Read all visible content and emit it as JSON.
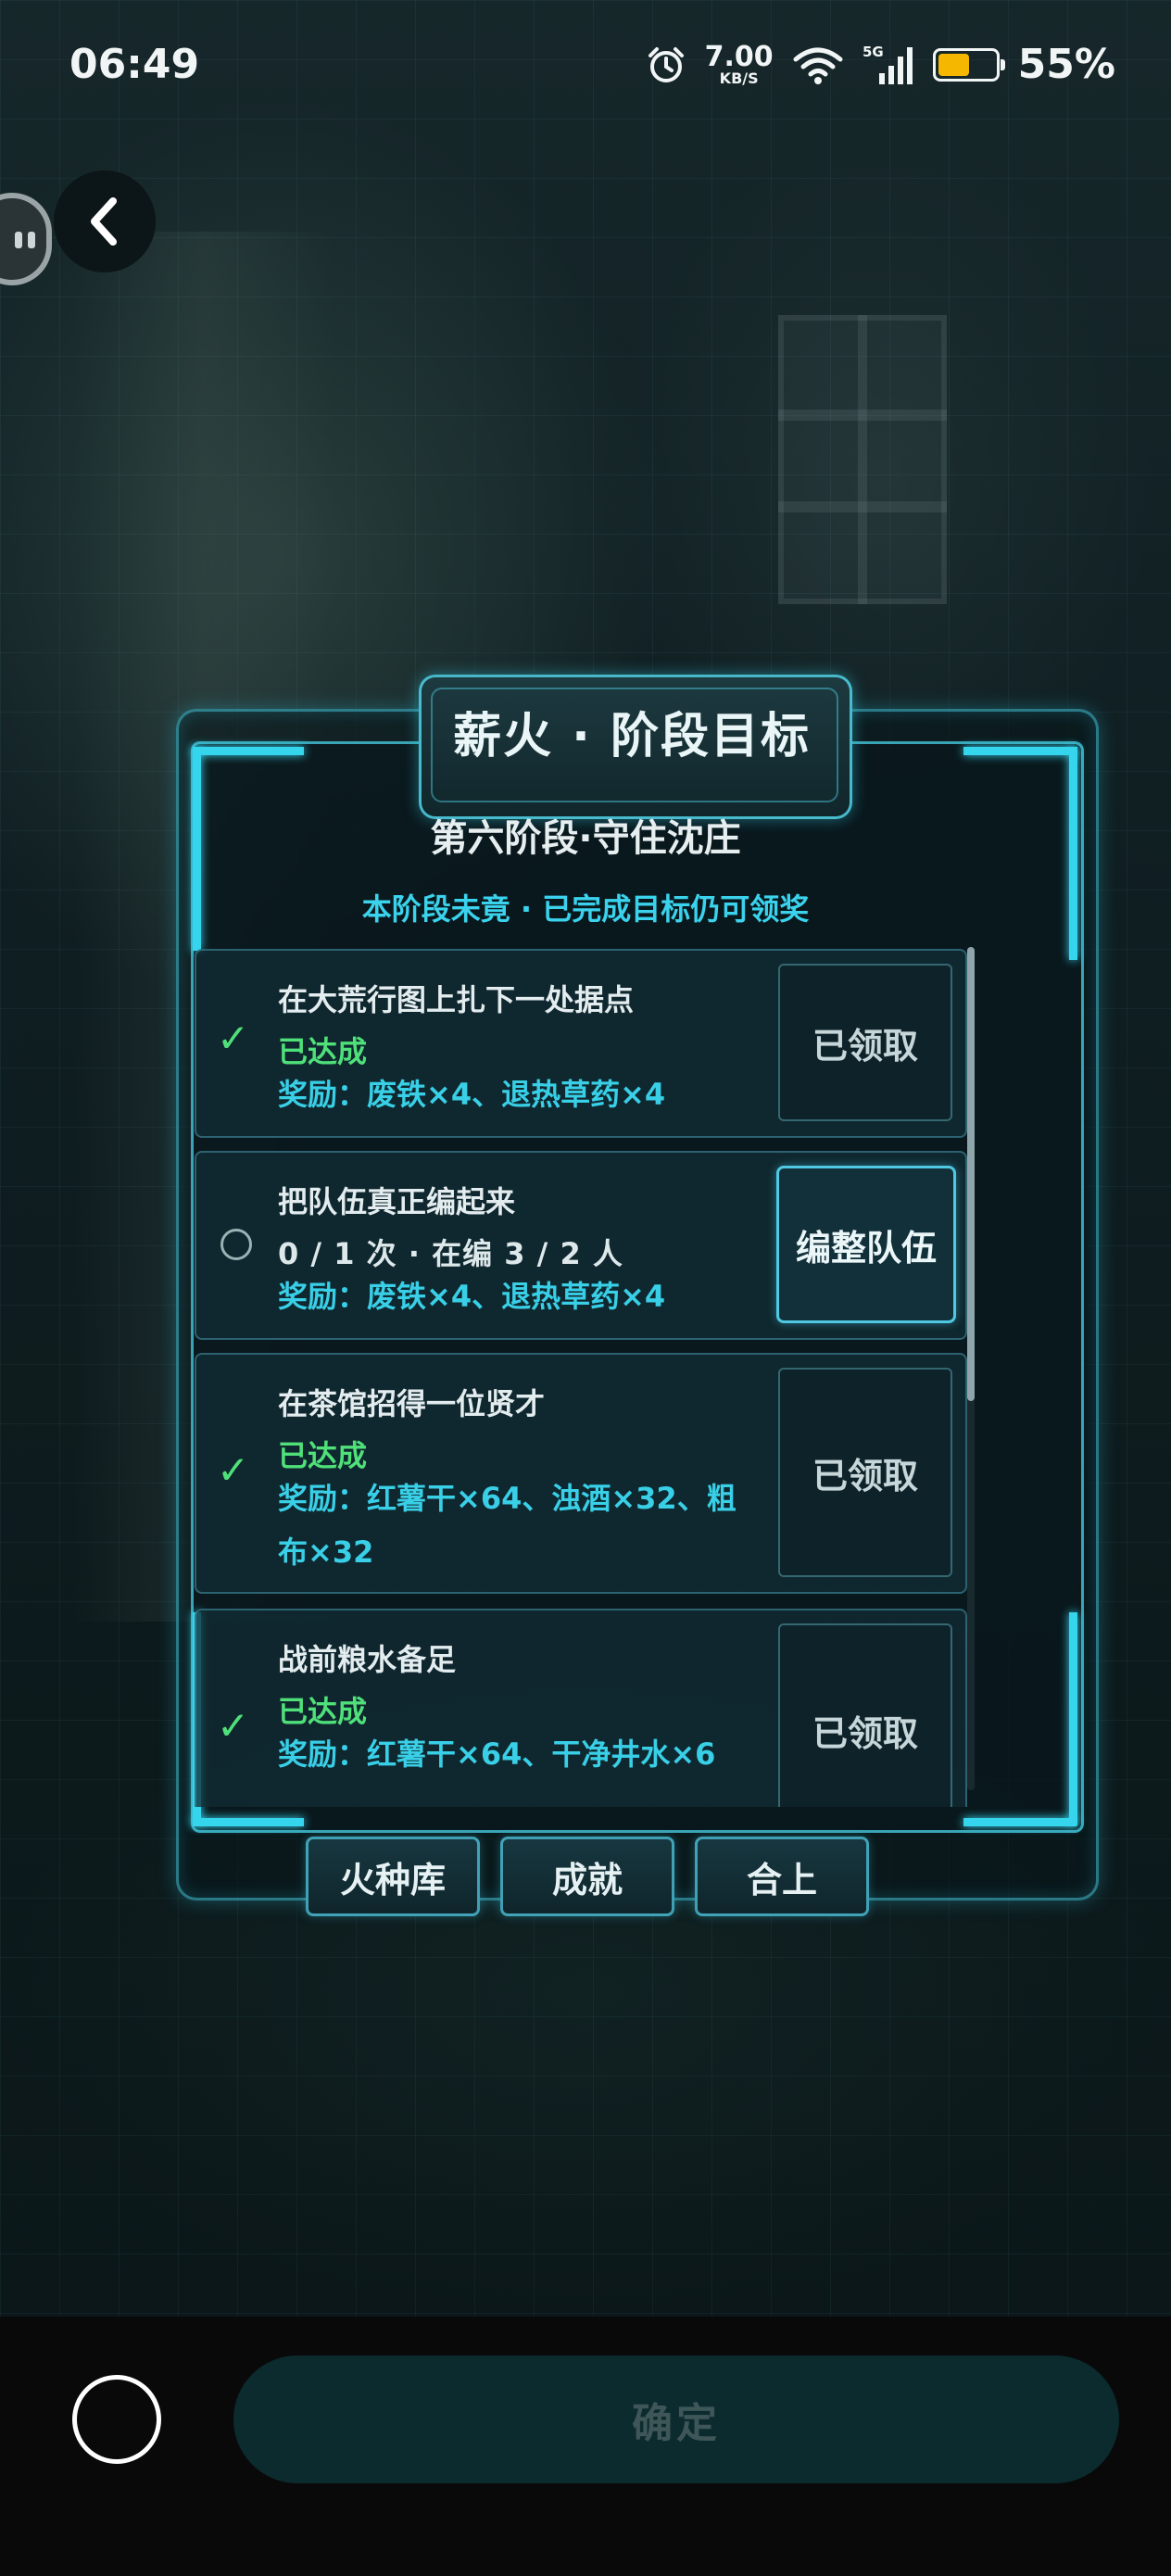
{
  "status_bar": {
    "time": "06:49",
    "net_speed_value": "7.00",
    "net_speed_unit": "KB/S",
    "network_type": "5G",
    "battery_percent": "55%",
    "battery_level": 0.55,
    "battery_color": "#f5b700"
  },
  "panel": {
    "title": "薪火 · 阶段目标",
    "stage_title": "第六阶段·守住沈庄",
    "stage_note": "本阶段未竟 · 已完成目标仍可领奖",
    "accent_color": "#36d5ee"
  },
  "tasks": [
    {
      "name": "在大荒行图上扎下一处据点",
      "status_icon": "check-icon",
      "progress": "已达成",
      "reward": "奖励：废铁×4、退热草药×4",
      "button_label": "已领取"
    },
    {
      "name": "把队伍真正编起来",
      "status_icon": "empty-circle-icon",
      "progress": "0 / 1 次 · 在编 3 / 2 人",
      "reward": "奖励：废铁×4、退热草药×4",
      "button_label": "编整队伍"
    },
    {
      "name": "在茶馆招得一位贤才",
      "status_icon": "check-icon",
      "progress": "已达成",
      "reward": "奖励：红薯干×64、浊酒×32、粗布×32",
      "button_label": "已领取"
    },
    {
      "name": "战前粮水备足",
      "status_icon": "check-icon",
      "progress": "已达成",
      "reward": "奖励：红薯干×64、干净井水×6",
      "button_label": "已领取"
    }
  ],
  "bottom_tabs": [
    "火种库",
    "成就",
    "合上"
  ],
  "footer": {
    "confirm_label": "确定"
  },
  "colors": {
    "done_green": "#4fe07a",
    "reward_cyan": "#38cfe7"
  }
}
